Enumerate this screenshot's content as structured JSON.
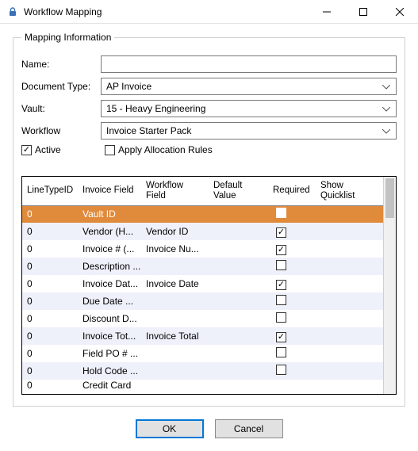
{
  "window": {
    "title": "Workflow Mapping"
  },
  "group": {
    "legend": "Mapping Information",
    "name_label": "Name:",
    "name_value": "",
    "doctype_label": "Document Type:",
    "doctype_value": "AP Invoice",
    "vault_label": "Vault:",
    "vault_value": "15 - Heavy Engineering",
    "workflow_label": "Workflow",
    "workflow_value": "Invoice Starter Pack",
    "active_label": "Active",
    "active_checked": true,
    "allocation_label": "Apply Allocation Rules",
    "allocation_checked": false
  },
  "grid": {
    "headers": {
      "linetype": "LineTypeID",
      "invoice_field": "Invoice Field",
      "workflow_field": "Workflow Field",
      "default_value": "Default Value",
      "required": "Required",
      "show_quicklist": "Show Quicklist"
    },
    "rows": [
      {
        "linetype": "0",
        "invoice_field": "Vault ID",
        "workflow_field": "",
        "default_value": "",
        "required": false,
        "selected": true
      },
      {
        "linetype": "0",
        "invoice_field": "Vendor   (H...",
        "workflow_field": "Vendor ID",
        "default_value": "",
        "required": true,
        "selected": false
      },
      {
        "linetype": "0",
        "invoice_field": "Invoice #  (...",
        "workflow_field": "Invoice Nu...",
        "default_value": "",
        "required": true,
        "selected": false
      },
      {
        "linetype": "0",
        "invoice_field": "Description ...",
        "workflow_field": "",
        "default_value": "",
        "required": false,
        "selected": false
      },
      {
        "linetype": "0",
        "invoice_field": "Invoice Dat...",
        "workflow_field": "Invoice Date",
        "default_value": "",
        "required": true,
        "selected": false
      },
      {
        "linetype": "0",
        "invoice_field": "Due Date   ...",
        "workflow_field": "",
        "default_value": "",
        "required": false,
        "selected": false
      },
      {
        "linetype": "0",
        "invoice_field": "Discount D...",
        "workflow_field": "",
        "default_value": "",
        "required": false,
        "selected": false
      },
      {
        "linetype": "0",
        "invoice_field": "Invoice Tot...",
        "workflow_field": "Invoice Total",
        "default_value": "",
        "required": true,
        "selected": false
      },
      {
        "linetype": "0",
        "invoice_field": "Field PO # ...",
        "workflow_field": "",
        "default_value": "",
        "required": false,
        "selected": false
      },
      {
        "linetype": "0",
        "invoice_field": "Hold Code ...",
        "workflow_field": "",
        "default_value": "",
        "required": false,
        "selected": false
      },
      {
        "linetype": "0",
        "invoice_field": "Credit Card",
        "workflow_field": "",
        "default_value": "",
        "required": false,
        "selected": false,
        "partial": true
      }
    ]
  },
  "buttons": {
    "ok": "OK",
    "cancel": "Cancel"
  }
}
